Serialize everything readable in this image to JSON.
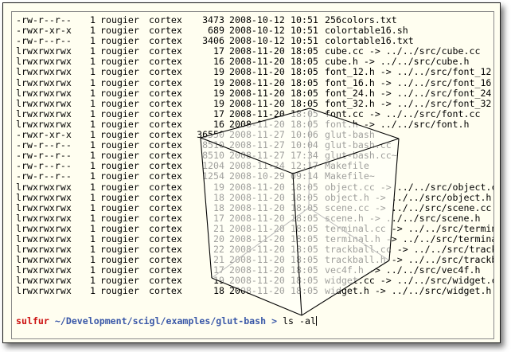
{
  "listing": [
    {
      "perm": "-rw-r--r--",
      "links": "1",
      "user": "rougier",
      "group": "cortex",
      "size": "3473",
      "date": "2008-10-12",
      "time": "10:51",
      "name": "256colors.txt"
    },
    {
      "perm": "-rwxr-xr-x",
      "links": "1",
      "user": "rougier",
      "group": "cortex",
      "size": "689",
      "date": "2008-10-12",
      "time": "10:51",
      "name": "colortable16.sh"
    },
    {
      "perm": "-rw-r--r--",
      "links": "1",
      "user": "rougier",
      "group": "cortex",
      "size": "3406",
      "date": "2008-10-12",
      "time": "10:51",
      "name": "colortable16.txt"
    },
    {
      "perm": "lrwxrwxrwx",
      "links": "1",
      "user": "rougier",
      "group": "cortex",
      "size": "17",
      "date": "2008-11-20",
      "time": "18:05",
      "name": "cube.cc -> ../../src/cube.cc"
    },
    {
      "perm": "lrwxrwxrwx",
      "links": "1",
      "user": "rougier",
      "group": "cortex",
      "size": "16",
      "date": "2008-11-20",
      "time": "18:05",
      "name": "cube.h -> ../../src/cube.h"
    },
    {
      "perm": "lrwxrwxrwx",
      "links": "1",
      "user": "rougier",
      "group": "cortex",
      "size": "19",
      "date": "2008-11-20",
      "time": "18:05",
      "name": "font_12.h -> ../../src/font_12.h"
    },
    {
      "perm": "lrwxrwxrwx",
      "links": "1",
      "user": "rougier",
      "group": "cortex",
      "size": "19",
      "date": "2008-11-20",
      "time": "18:05",
      "name": "font_16.h -> ../../src/font_16.h"
    },
    {
      "perm": "lrwxrwxrwx",
      "links": "1",
      "user": "rougier",
      "group": "cortex",
      "size": "19",
      "date": "2008-11-20",
      "time": "18:05",
      "name": "font_24.h -> ../../src/font_24.h"
    },
    {
      "perm": "lrwxrwxrwx",
      "links": "1",
      "user": "rougier",
      "group": "cortex",
      "size": "19",
      "date": "2008-11-20",
      "time": "18:05",
      "name": "font_32.h -> ../../src/font_32.h"
    },
    {
      "perm": "lrwxrwxrwx",
      "links": "1",
      "user": "rougier",
      "group": "cortex",
      "size": "17",
      "date": "2008-11-20",
      "time": "18:05",
      "name": "font.cc -> ../../src/font.cc"
    },
    {
      "perm": "lrwxrwxrwx",
      "links": "1",
      "user": "rougier",
      "group": "cortex",
      "size": "16",
      "date": "2008-11-20",
      "time": "18:05",
      "name": "font.h -> ../../src/font.h"
    },
    {
      "perm": "-rwxr-xr-x",
      "links": "1",
      "user": "rougier",
      "group": "cortex",
      "size": "36550",
      "date": "2008-11-27",
      "time": "10:06",
      "name": "glut-bash"
    },
    {
      "perm": "-rw-r--r--",
      "links": "1",
      "user": "rougier",
      "group": "cortex",
      "size": "8510",
      "date": "2008-11-27",
      "time": "10:04",
      "name": "glut-bash.cc"
    },
    {
      "perm": "-rw-r--r--",
      "links": "1",
      "user": "rougier",
      "group": "cortex",
      "size": "8510",
      "date": "2008-11-27",
      "time": "17:34",
      "name": "glut-bash.cc~"
    },
    {
      "perm": "-rw-r--r--",
      "links": "1",
      "user": "rougier",
      "group": "cortex",
      "size": "1204",
      "date": "2008-11-24",
      "time": "12:17",
      "name": "Makefile"
    },
    {
      "perm": "-rw-r--r--",
      "links": "1",
      "user": "rougier",
      "group": "cortex",
      "size": "1254",
      "date": "2008-10-29",
      "time": "09:14",
      "name": "Makefile~"
    },
    {
      "perm": "lrwxrwxrwx",
      "links": "1",
      "user": "rougier",
      "group": "cortex",
      "size": "19",
      "date": "2008-11-20",
      "time": "18:05",
      "name": "object.cc -> ../../src/object.cc"
    },
    {
      "perm": "lrwxrwxrwx",
      "links": "1",
      "user": "rougier",
      "group": "cortex",
      "size": "18",
      "date": "2008-11-20",
      "time": "18:05",
      "name": "object.h -> ../../src/object.h"
    },
    {
      "perm": "lrwxrwxrwx",
      "links": "1",
      "user": "rougier",
      "group": "cortex",
      "size": "18",
      "date": "2008-11-20",
      "time": "18:05",
      "name": "scene.cc -> ../../src/scene.cc"
    },
    {
      "perm": "lrwxrwxrwx",
      "links": "1",
      "user": "rougier",
      "group": "cortex",
      "size": "17",
      "date": "2008-11-20",
      "time": "18:05",
      "name": "scene.h -> ../../src/scene.h"
    },
    {
      "perm": "lrwxrwxrwx",
      "links": "1",
      "user": "rougier",
      "group": "cortex",
      "size": "21",
      "date": "2008-11-20",
      "time": "18:05",
      "name": "terminal.cc -> ../../src/terminal.cc"
    },
    {
      "perm": "lrwxrwxrwx",
      "links": "1",
      "user": "rougier",
      "group": "cortex",
      "size": "20",
      "date": "2008-11-20",
      "time": "18:05",
      "name": "terminal.h -> ../../src/terminal.h"
    },
    {
      "perm": "lrwxrwxrwx",
      "links": "1",
      "user": "rougier",
      "group": "cortex",
      "size": "22",
      "date": "2008-11-20",
      "time": "18:05",
      "name": "trackball.cc -> ../../src/trackball.cc"
    },
    {
      "perm": "lrwxrwxrwx",
      "links": "1",
      "user": "rougier",
      "group": "cortex",
      "size": "21",
      "date": "2008-11-20",
      "time": "18:05",
      "name": "trackball.h -> ../../src/trackball.h"
    },
    {
      "perm": "lrwxrwxrwx",
      "links": "1",
      "user": "rougier",
      "group": "cortex",
      "size": "17",
      "date": "2008-11-20",
      "time": "18:05",
      "name": "vec4f.h -> ../../src/vec4f.h"
    },
    {
      "perm": "lrwxrwxrwx",
      "links": "1",
      "user": "rougier",
      "group": "cortex",
      "size": "19",
      "date": "2008-11-20",
      "time": "18:05",
      "name": "widget.cc -> ../../src/widget.cc"
    },
    {
      "perm": "lrwxrwxrwx",
      "links": "1",
      "user": "rougier",
      "group": "cortex",
      "size": "18",
      "date": "2008-11-20",
      "time": "18:05",
      "name": "widget.h -> ../../src/widget.h"
    }
  ],
  "prompt": {
    "host": "sulfur",
    "path": "~/Development/scigl/examples/glut-bash",
    "symbol": ">",
    "command": "ls -al"
  },
  "colors": {
    "background": "#fffef0",
    "host": "#cc1010",
    "path": "#3a58a8",
    "text": "#000000"
  }
}
